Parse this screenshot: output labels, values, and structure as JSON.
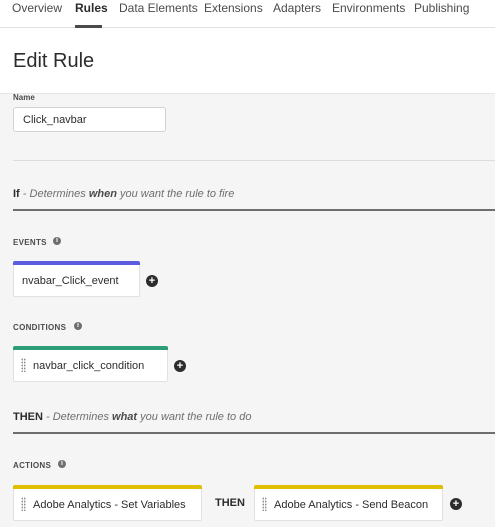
{
  "nav": {
    "tabs": [
      {
        "label": "Overview"
      },
      {
        "label": "Rules"
      },
      {
        "label": "Data Elements"
      },
      {
        "label": "Extensions"
      },
      {
        "label": "Adapters"
      },
      {
        "label": "Environments"
      },
      {
        "label": "Publishing"
      }
    ],
    "active": "Rules"
  },
  "header": {
    "title": "Edit Rule"
  },
  "name_field": {
    "label": "Name",
    "value": "Click_navbar"
  },
  "if_section": {
    "keyword": "If",
    "desc_prefix": " - Determines ",
    "desc_emph": "when",
    "desc_suffix": " you want the rule to fire"
  },
  "events": {
    "label": "EVENTS",
    "items": [
      {
        "label": "nvabar_Click_event",
        "color": "#5c5ce0"
      }
    ]
  },
  "conditions": {
    "label": "CONDITIONS",
    "items": [
      {
        "label": "navbar_click_condition",
        "color": "#2d9d78"
      }
    ]
  },
  "then_section": {
    "keyword": "THEN",
    "desc_prefix": " - Determines ",
    "desc_emph": "what",
    "desc_suffix": " you want the rule to do"
  },
  "actions": {
    "label": "ACTIONS",
    "items": [
      {
        "label": "Adobe Analytics - Set Variables",
        "color": "#dfbf00"
      },
      {
        "label": "Adobe Analytics - Send Beacon",
        "color": "#dfbf00"
      }
    ],
    "connector": "THEN"
  },
  "icons": {
    "info": "info-icon",
    "add": "add-icon",
    "drag": "drag-handle-icon"
  }
}
